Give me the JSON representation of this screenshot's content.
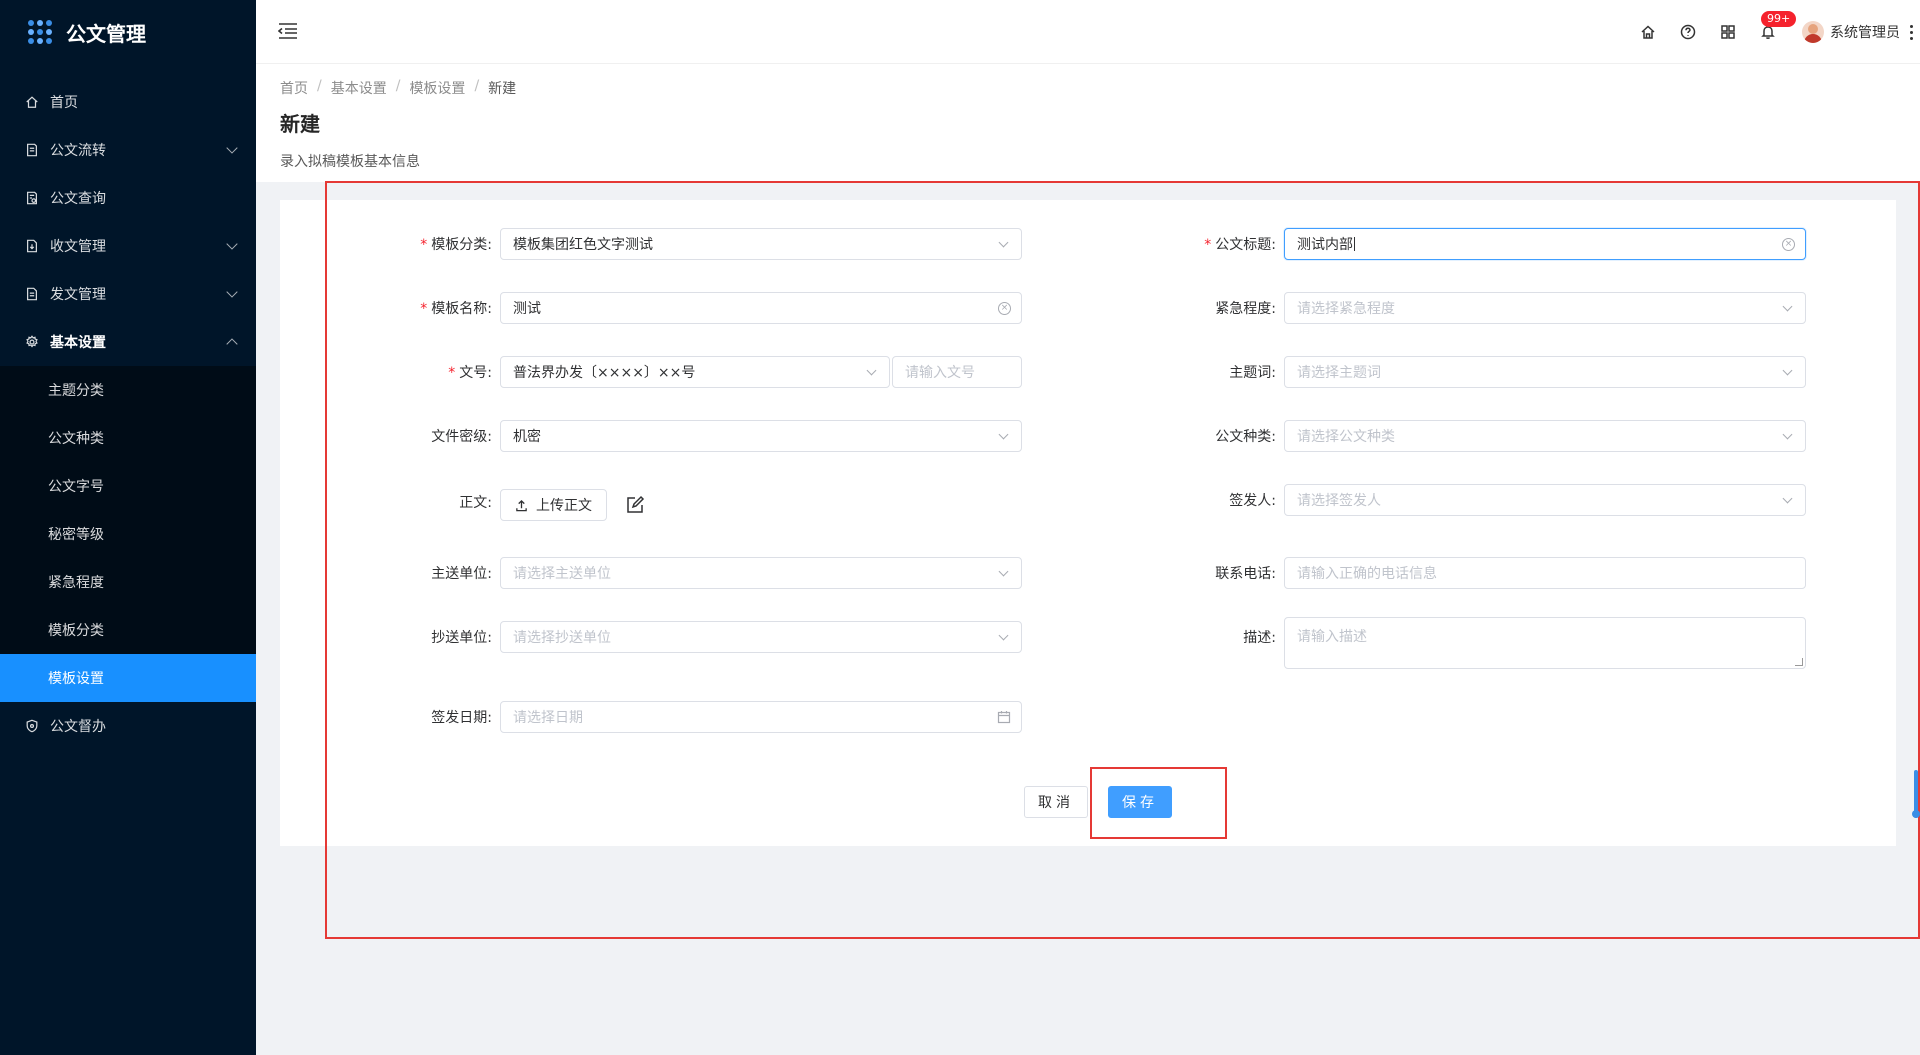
{
  "app": {
    "title": "公文管理"
  },
  "sidebar": {
    "items": [
      {
        "label": "首页",
        "icon": "home-icon"
      },
      {
        "label": "公文流转",
        "icon": "document-flow-icon",
        "expandable": true
      },
      {
        "label": "公文查询",
        "icon": "document-search-icon"
      },
      {
        "label": "收文管理",
        "icon": "document-in-icon",
        "expandable": true
      },
      {
        "label": "发文管理",
        "icon": "document-out-icon",
        "expandable": true
      },
      {
        "label": "基本设置",
        "icon": "gear-icon",
        "expandable": true,
        "open": true
      }
    ],
    "submenu": [
      {
        "label": "主题分类"
      },
      {
        "label": "公文种类"
      },
      {
        "label": "公文字号"
      },
      {
        "label": "秘密等级"
      },
      {
        "label": "紧急程度"
      },
      {
        "label": "模板分类"
      },
      {
        "label": "模板设置",
        "active": true
      }
    ],
    "bottom_item": {
      "label": "公文督办",
      "icon": "shield-icon"
    }
  },
  "header": {
    "notification_badge": "99+",
    "user_name": "系统管理员"
  },
  "breadcrumb": [
    "首页",
    "基本设置",
    "模板设置",
    "新建"
  ],
  "page": {
    "title": "新建",
    "description": "录入拟稿模板基本信息"
  },
  "form": {
    "template_category": {
      "label": "模板分类:",
      "required": true,
      "value": "模板集团红色文字测试"
    },
    "template_name": {
      "label": "模板名称:",
      "required": true,
      "value": "测试"
    },
    "doc_number": {
      "label": "文号:",
      "required": true,
      "value": "普法界办发〔××××〕××号",
      "placeholder": "请输入文号"
    },
    "secret_level": {
      "label": "文件密级:",
      "value": "机密"
    },
    "body": {
      "label": "正文:",
      "upload_label": "上传正文"
    },
    "main_recipient": {
      "label": "主送单位:",
      "placeholder": "请选择主送单位"
    },
    "cc_recipient": {
      "label": "抄送单位:",
      "placeholder": "请选择抄送单位"
    },
    "sign_date": {
      "label": "签发日期:",
      "placeholder": "请选择日期"
    },
    "doc_title": {
      "label": "公文标题:",
      "required": true,
      "value": "测试内部"
    },
    "urgency": {
      "label": "紧急程度:",
      "placeholder": "请选择紧急程度"
    },
    "subject_word": {
      "label": "主题词:",
      "placeholder": "请选择主题词"
    },
    "doc_type": {
      "label": "公文种类:",
      "placeholder": "请选择公文种类"
    },
    "signer": {
      "label": "签发人:",
      "placeholder": "请选择签发人"
    },
    "phone": {
      "label": "联系电话:",
      "placeholder": "请输入正确的电话信息"
    },
    "description": {
      "label": "描述:",
      "placeholder": "请输入描述"
    },
    "cancel_label": "取消",
    "save_label": "保存"
  },
  "colors": {
    "sidebar_bg": "#001529",
    "active_menu": "#1890ff",
    "primary": "#409eff",
    "highlight": "#e53935",
    "required": "#f5222d"
  }
}
